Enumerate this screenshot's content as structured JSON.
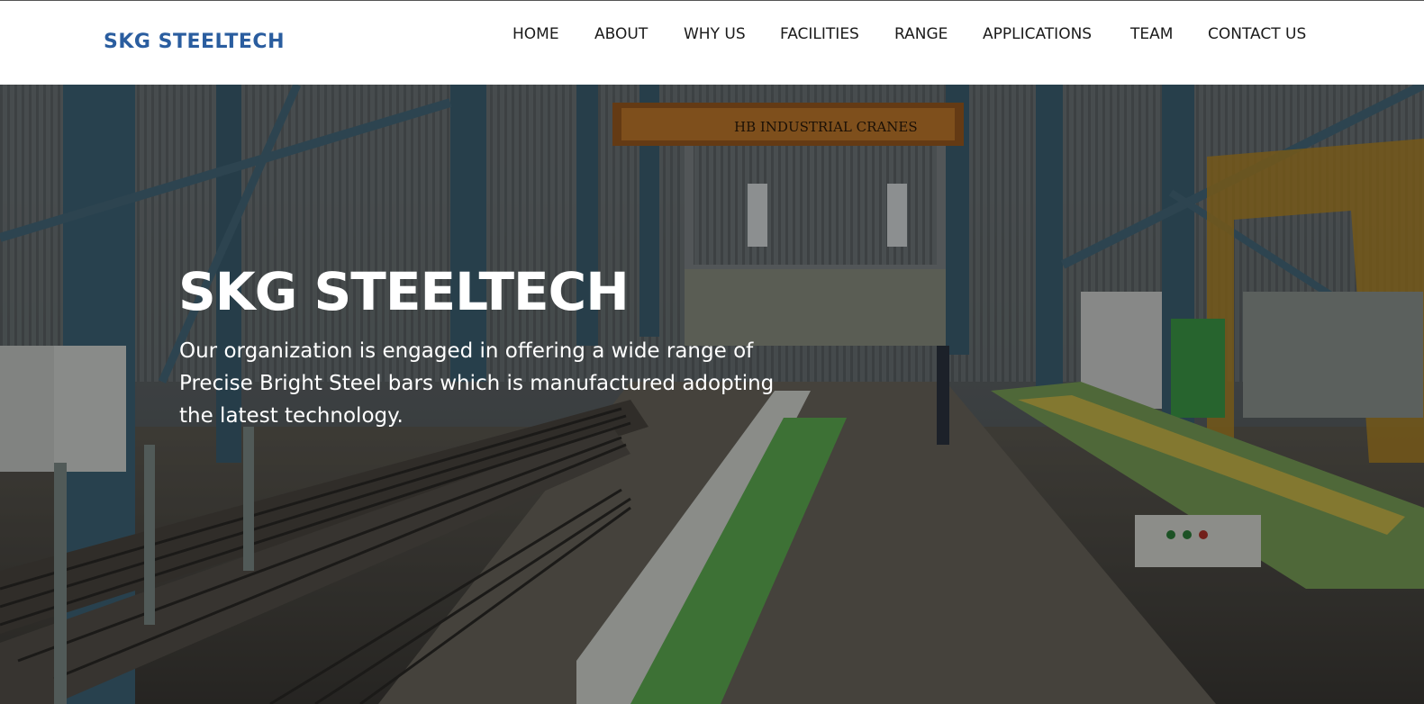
{
  "header": {
    "brand": "SKG STEELTECH",
    "nav": [
      {
        "key": "home",
        "label": "HOME"
      },
      {
        "key": "about",
        "label": "ABOUT"
      },
      {
        "key": "why-us",
        "label": "WHY US"
      },
      {
        "key": "facilities",
        "label": "FACILITIES"
      },
      {
        "key": "range",
        "label": "RANGE"
      },
      {
        "key": "applications",
        "label": "APPLICATIONS"
      },
      {
        "key": "team",
        "label": "TEAM"
      },
      {
        "key": "contact-us",
        "label": "CONTACT US"
      }
    ]
  },
  "hero": {
    "title": "SKG STEELTECH",
    "description": "Our organization is engaged in offering a wide range of Precise Bright Steel bars which is manufactured adopting the latest technology.",
    "crane_sign": "HB INDUSTRIAL CRANES"
  },
  "colors": {
    "brand": "#2a5d9f",
    "nav_text": "#1a1a1a",
    "hero_text": "#ffffff"
  }
}
